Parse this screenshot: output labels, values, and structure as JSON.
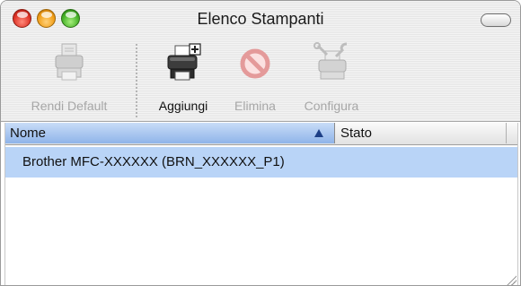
{
  "window": {
    "title": "Elenco Stampanti"
  },
  "toolbar": {
    "buttons": [
      {
        "id": "default",
        "label": "Rendi Default",
        "icon": "printer-default-icon",
        "enabled": false
      },
      {
        "id": "add",
        "label": "Aggiungi",
        "icon": "printer-add-icon",
        "enabled": true
      },
      {
        "id": "delete",
        "label": "Elimina",
        "icon": "delete-icon",
        "enabled": false
      },
      {
        "id": "configure",
        "label": "Configura",
        "icon": "printer-configure-icon",
        "enabled": false
      }
    ]
  },
  "table": {
    "columns": [
      {
        "label": "Nome",
        "sorted": "ascending"
      },
      {
        "label": "Stato"
      }
    ],
    "rows": [
      {
        "name": "Brother MFC-XXXXXX  (BRN_XXXXXX_P1)",
        "status": "",
        "selected": true
      }
    ]
  },
  "colors": {
    "selection": "#b9d4f7",
    "header_active": "#a9c6f0",
    "close": "#e0362a",
    "minimize": "#f2a01a",
    "zoom": "#48b42a"
  }
}
